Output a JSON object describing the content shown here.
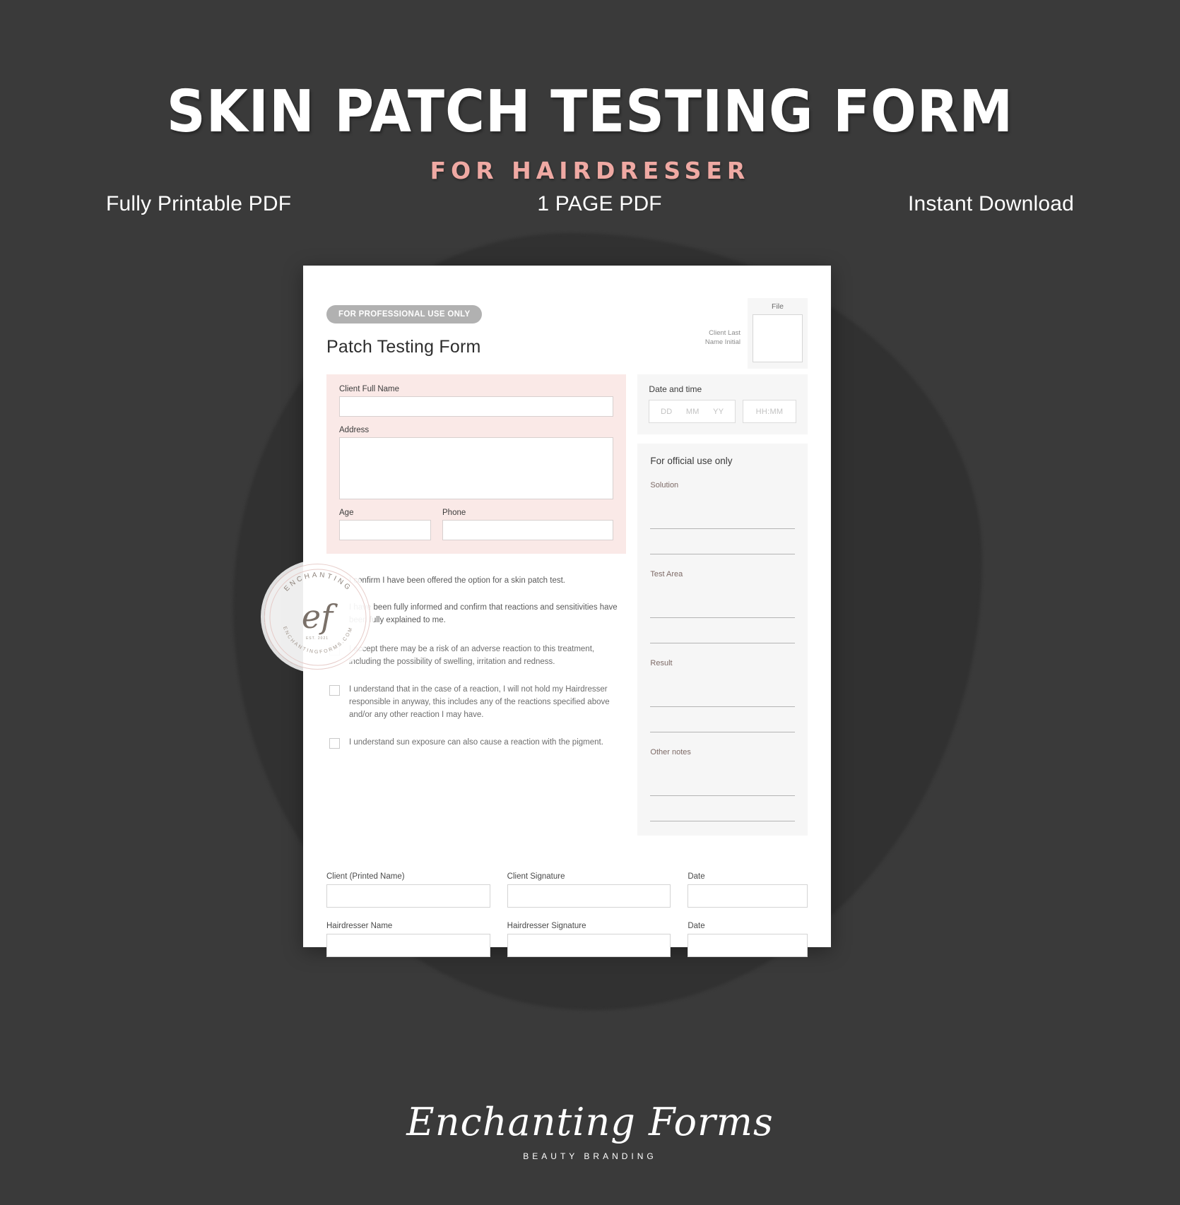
{
  "promo": {
    "title": "SKIN PATCH TESTING FORM",
    "subtitle": "FOR HAIRDRESSER",
    "features": [
      "Fully Printable PDF",
      "1 PAGE PDF",
      "Instant Download"
    ],
    "accent_color": "#efa9a3",
    "background_color": "#3a3a3a"
  },
  "form": {
    "badge": "FOR PROFESSIONAL USE ONLY",
    "title": "Patch Testing Form",
    "client_initial_label": "Client Last\nName Initial",
    "file": {
      "label": "File",
      "value": ""
    },
    "client": {
      "name_label": "Client Full Name",
      "name_value": "",
      "address_label": "Address",
      "address_value": "",
      "age_label": "Age",
      "age_value": "",
      "phone_label": "Phone",
      "phone_value": "",
      "card_color": "#fae9e7"
    },
    "datetime": {
      "title": "Date and time",
      "day_placeholder": "DD",
      "month_placeholder": "MM",
      "year_placeholder": "YY",
      "time_placeholder": "HH:MM",
      "day_value": "",
      "month_value": "",
      "year_value": "",
      "time_value": ""
    },
    "official": {
      "title": "For official use only",
      "blocks": [
        {
          "label": "Solution",
          "line1": "",
          "line2": ""
        },
        {
          "label": "Test Area",
          "line1": "",
          "line2": ""
        },
        {
          "label": "Result",
          "line1": "",
          "line2": ""
        },
        {
          "label": "Other notes",
          "line1": "",
          "line2": ""
        }
      ]
    },
    "consent": {
      "intro_1": "I confirm I have been offered the option for a skin patch test.",
      "intro_2": "I have been fully informed and confirm that reactions and sensitivities have been fully explained to me.",
      "items": [
        "I accept there may be a risk of an adverse reaction to this treatment, including the possibility of swelling, irritation and redness.",
        "I understand that in the case of a reaction, I will not hold my Hairdresser responsible in anyway, this includes any of the reactions specified above and/or any other reaction I may have.",
        "I understand sun exposure can also cause a reaction with the pigment."
      ]
    },
    "signatures": {
      "row1": [
        {
          "label": "Client (Printed Name)",
          "value": ""
        },
        {
          "label": "Client Signature",
          "value": ""
        },
        {
          "label": "Date",
          "value": ""
        }
      ],
      "row2": [
        {
          "label": "Hairdresser Name",
          "value": ""
        },
        {
          "label": "Hairdresser Signature",
          "value": ""
        },
        {
          "label": "Date",
          "value": ""
        }
      ]
    }
  },
  "watermark": {
    "arc_top": "ENCHANTING",
    "monogram": "ef",
    "arc_bottom": "ENCHANTINGFORMS.COM",
    "tiny": "EST. 2021"
  },
  "brand": {
    "name": "Enchanting Forms",
    "tagline": "BEAUTY BRANDING"
  }
}
